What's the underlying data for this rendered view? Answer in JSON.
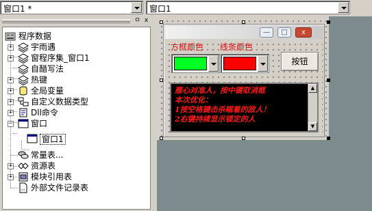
{
  "toolbar": {
    "object_combo": "窗口1 *",
    "event_combo": "窗口1"
  },
  "tree": {
    "buttons": [
      "ㅁ",
      "x"
    ],
    "root": "程序数据",
    "items": [
      {
        "label": "宇雨遇"
      },
      {
        "label": "窗程序集_窗口1"
      },
      {
        "label": "自醋写法"
      },
      {
        "label": "热键"
      },
      {
        "label": "全局变量"
      },
      {
        "label": "自定义数据类型"
      },
      {
        "label": "Dll命令"
      },
      {
        "label": "窗口"
      },
      {
        "label": "窗口1"
      },
      {
        "label": "常量表..."
      },
      {
        "label": "资源表"
      },
      {
        "label": "模块引用表"
      },
      {
        "label": "外部文件记录表"
      }
    ]
  },
  "designer": {
    "caption_buttons": {
      "minimize": "—",
      "maximize": "□",
      "close": "x"
    },
    "label_box_color": "方框颜色",
    "label_line_color": "线条颜色",
    "box_color": "#00ff22",
    "line_color": "#ff0000",
    "button_label": "按钮",
    "messages": [
      "雁心对准人，按中键取消框",
      "本次优化：",
      "1按空格键击杀瞄着的敌人！",
      "2右键持续显示锁定的人"
    ],
    "scroll_up": "▲",
    "scroll_down": "▼"
  }
}
